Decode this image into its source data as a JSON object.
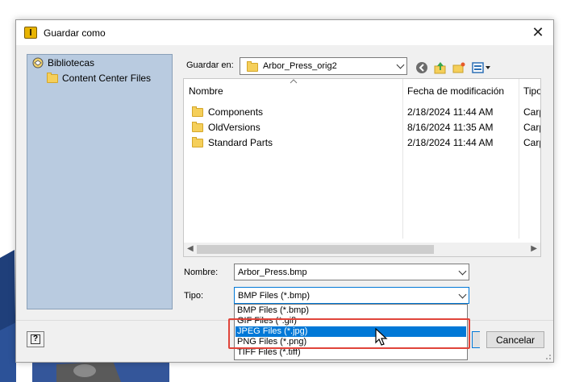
{
  "dialog": {
    "title": "Guardar como",
    "close_glyph": "✕",
    "app_icon": "autodesk-inventor-icon"
  },
  "places": {
    "items": [
      {
        "label": "Bibliotecas",
        "icon": "library-icon"
      },
      {
        "label": "Content Center Files",
        "icon": "folder-icon"
      }
    ]
  },
  "save_in": {
    "label": "Guardar en:",
    "value": "Arbor_Press_orig2"
  },
  "toolbar": {
    "icons": [
      "back-icon",
      "up-folder-icon",
      "new-folder-icon",
      "view-menu-icon"
    ]
  },
  "filelist": {
    "columns": [
      "Nombre",
      "Fecha de modificación",
      "Tipo"
    ],
    "rows": [
      {
        "name": "Components",
        "date": "2/18/2024 11:44 AM",
        "type": "Carp"
      },
      {
        "name": "OldVersions",
        "date": "8/16/2024 11:35 AM",
        "type": "Carp"
      },
      {
        "name": "Standard Parts",
        "date": "2/18/2024 11:44 AM",
        "type": "Carp"
      }
    ]
  },
  "filename": {
    "label": "Nombre:",
    "value": "Arbor_Press.bmp"
  },
  "filetype": {
    "label": "Tipo:",
    "value": "BMP Files (*.bmp)",
    "options": [
      "BMP Files (*.bmp)",
      "GIF Files (*.gif)",
      "JPEG Files (*.jpg)",
      "PNG Files (*.png)",
      "TIFF Files (*.tiff)"
    ],
    "selected_option": "JPEG Files (*.jpg)"
  },
  "buttons": {
    "cancel": "Cancelar",
    "help_glyph": "?"
  },
  "colors": {
    "places_bg": "#b9cbe0",
    "selection": "#0078d7",
    "highlight": "#e0443a",
    "folder": "#f5cf5a"
  }
}
